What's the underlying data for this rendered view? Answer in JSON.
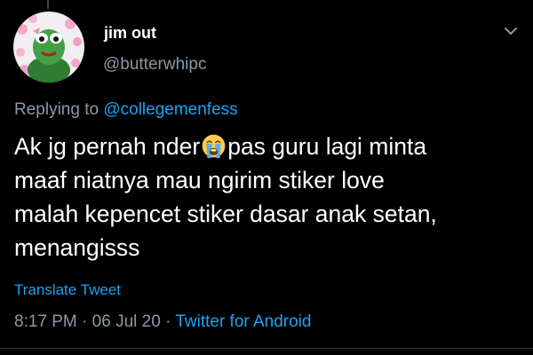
{
  "tweet": {
    "author": {
      "display_name": "jim out",
      "handle": "@butterwhipc"
    },
    "replying_prefix": "Replying to",
    "replying_to": "@collegemenfess",
    "text_lines": [
      {
        "before": "Ak jg pernah nder",
        "emoji": "loudly-crying-face",
        "after": "pas guru lagi minta"
      },
      "maaf niatnya mau ngirim stiker love",
      "malah kepencet stiker dasar anak setan,",
      "menangisss"
    ],
    "translate_label": "Translate Tweet",
    "time": "8:17 PM",
    "separator": "·",
    "date": "06 Jul 20",
    "source": "Twitter for Android"
  },
  "icons": {
    "menu": "chevron-down-icon",
    "avatar": "avatar-image",
    "emoji": "loudly-crying-face-icon"
  },
  "colors": {
    "background": "#000000",
    "text": "#ffffff",
    "secondary": "#8899a6",
    "accent": "#1da1f2"
  }
}
